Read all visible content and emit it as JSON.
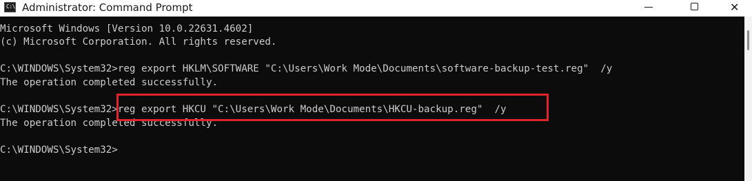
{
  "window": {
    "title": "Administrator: Command Prompt",
    "icon": "cmd-icon",
    "icon_text": "C:\\",
    "minimize_icon": "minimize-icon",
    "maximize_icon": "maximize-icon",
    "close_icon": "close-icon",
    "close_glyph": "✕"
  },
  "console": {
    "lines": [
      "Microsoft Windows [Version 10.0.22631.4602]",
      "(c) Microsoft Corporation. All rights reserved.",
      "",
      "C:\\WINDOWS\\System32>reg export HKLM\\SOFTWARE \"C:\\Users\\Work Mode\\Documents\\software-backup-test.reg\"  /y",
      "The operation completed successfully.",
      "",
      "C:\\WINDOWS\\System32>reg export HKCU \"C:\\Users\\Work Mode\\Documents\\HKCU-backup.reg\"  /y",
      "The operation completed successfully.",
      "",
      "C:\\WINDOWS\\System32>"
    ]
  },
  "colors": {
    "background": "#0c0c0c",
    "text": "#cccccc",
    "highlight": "#e0242c"
  }
}
